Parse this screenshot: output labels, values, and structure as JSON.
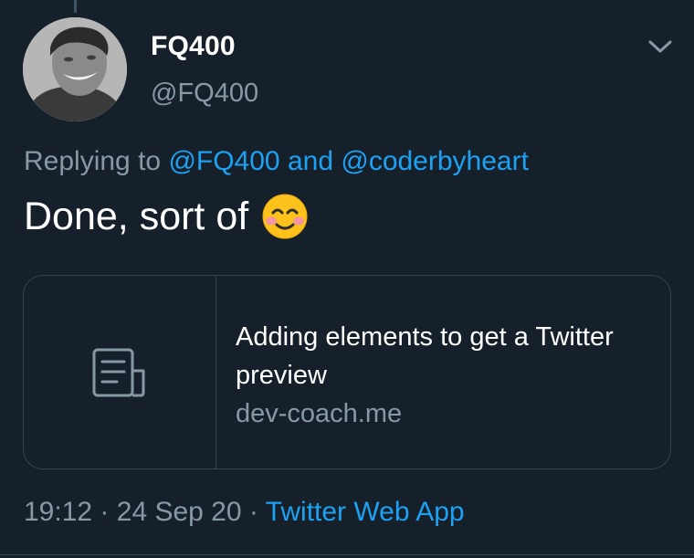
{
  "author": {
    "display_name": "FQ400",
    "handle": "@FQ400"
  },
  "reply": {
    "prefix": "Replying to",
    "mention_1": "@FQ400",
    "conjunction": "and",
    "mention_2": "@coderbyheart"
  },
  "tweet": {
    "text": "Done, sort of",
    "emoji": "smiling-face-with-blush-emoji"
  },
  "card": {
    "icon": "document-icon",
    "title": "Adding elements to get a Twitter preview",
    "domain": "dev-coach.me"
  },
  "meta": {
    "time": "19:12",
    "separator_1": "·",
    "date": "24 Sep 20",
    "separator_2": "·",
    "source": "Twitter Web App"
  },
  "colors": {
    "background": "#15202b",
    "accent": "#1da1f2",
    "secondary_text": "#8899a6",
    "border": "#38444d"
  }
}
